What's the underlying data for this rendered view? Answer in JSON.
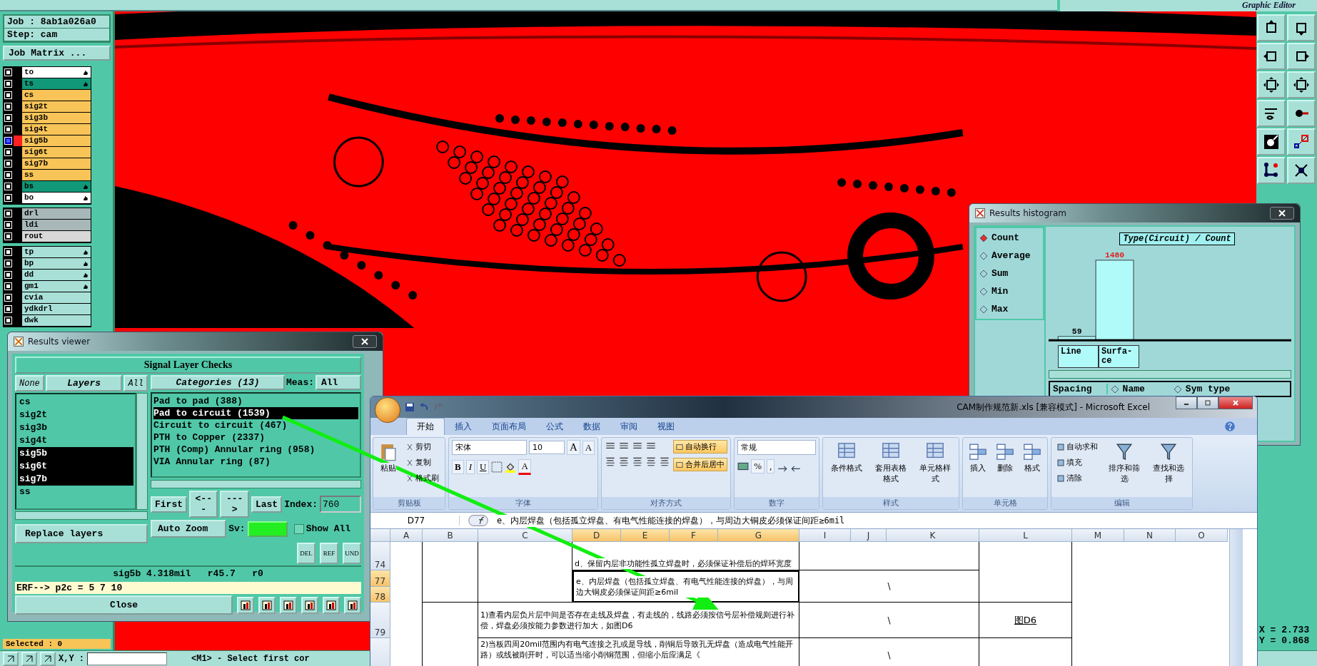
{
  "top_bar": {
    "subtitle": "Graphic Editor"
  },
  "job": {
    "job": "Job : 8ab1a026a0",
    "step": "Step: cam",
    "matrix_button": "Job Matrix ..."
  },
  "layer_groups": [
    {
      "layers": [
        {
          "name": "to",
          "color": "#ffffff",
          "selected": false,
          "marked": true
        },
        {
          "name": "ts",
          "color": "#109878",
          "selected": false,
          "marked": true
        },
        {
          "name": "cs",
          "color": "#f8c458",
          "selected": false,
          "marked": false
        },
        {
          "name": "sig2t",
          "color": "#f8c458",
          "selected": false,
          "marked": false
        },
        {
          "name": "sig3b",
          "color": "#f8c458",
          "selected": false,
          "marked": false
        },
        {
          "name": "sig4t",
          "color": "#f8c458",
          "selected": false,
          "marked": false
        },
        {
          "name": "sig5b",
          "color": "#f8c458",
          "selected": true,
          "marked": false
        },
        {
          "name": "sig6t",
          "color": "#f8c458",
          "selected": false,
          "marked": false
        },
        {
          "name": "sig7b",
          "color": "#f8c458",
          "selected": false,
          "marked": false
        },
        {
          "name": "ss",
          "color": "#f8c458",
          "selected": false,
          "marked": false
        },
        {
          "name": "bs",
          "color": "#109878",
          "selected": false,
          "marked": true
        },
        {
          "name": "bo",
          "color": "#ffffff",
          "selected": false,
          "marked": true
        }
      ]
    },
    {
      "layers": [
        {
          "name": "drl",
          "color": "#a8b8b8",
          "selected": false,
          "marked": false
        },
        {
          "name": "ldi",
          "color": "#a8b8b8",
          "selected": false,
          "marked": false
        },
        {
          "name": "rout",
          "color": "#d8d8d8",
          "selected": false,
          "marked": false
        }
      ]
    },
    {
      "layers": [
        {
          "name": "tp",
          "color": "#a8e0d8",
          "selected": false,
          "marked": true
        },
        {
          "name": "bp",
          "color": "#a8e0d8",
          "selected": false,
          "marked": true
        },
        {
          "name": "dd",
          "color": "#a8e0d8",
          "selected": false,
          "marked": true
        },
        {
          "name": "gm1",
          "color": "#a8e0d8",
          "selected": false,
          "marked": true
        },
        {
          "name": "cvia",
          "color": "#a8e0d8",
          "selected": false,
          "marked": false
        },
        {
          "name": "ydkdrl",
          "color": "#a8e0d8",
          "selected": false,
          "marked": false
        },
        {
          "name": "dwk",
          "color": "#a8e0d8",
          "selected": false,
          "marked": false
        }
      ]
    }
  ],
  "status": {
    "selected": "Selected : 0",
    "mouse_label": "X,Y :",
    "prompt": "<M1> - Select first cor"
  },
  "coords": {
    "x": "X = 2.733",
    "y": "Y = 0.868"
  },
  "results_viewer": {
    "title": "Results viewer",
    "header": "Signal Layer Checks",
    "layer_tabs": [
      {
        "label": "None",
        "selected": false
      },
      {
        "label": "Layers",
        "selected": true
      },
      {
        "label": "All",
        "selected": false
      }
    ],
    "layers": [
      {
        "name": "cs",
        "selected": false
      },
      {
        "name": "sig2t",
        "selected": false
      },
      {
        "name": "sig3b",
        "selected": false
      },
      {
        "name": "sig4t",
        "selected": false
      },
      {
        "name": "sig5b",
        "selected": true
      },
      {
        "name": "sig6t",
        "selected": true
      },
      {
        "name": "sig7b",
        "selected": true
      },
      {
        "name": "ss",
        "selected": false
      }
    ],
    "replace_dropdown": "Replace layers",
    "categories_button": "Categories (13)",
    "meas_label": "Meas:",
    "meas_value": "All",
    "categories": [
      {
        "label": "Pad to pad (388)",
        "selected": false
      },
      {
        "label": "Pad to circuit (1539)",
        "selected": true
      },
      {
        "label": "Circuit to circuit (467)",
        "selected": false
      },
      {
        "label": "PTH to Copper (2337)",
        "selected": false
      },
      {
        "label": "PTH (Comp) Annular ring (958)",
        "selected": false
      },
      {
        "label": "VIA Annular ring (87)",
        "selected": false
      }
    ],
    "nav_buttons": [
      "First",
      "<---",
      "--->",
      "Last"
    ],
    "index_label": "Index:",
    "index_value": "760",
    "zoom_dropdown": "Auto Zoom",
    "sv_label": "Sv:",
    "show_all": {
      "label": "Show All",
      "checked": false
    },
    "action_buttons": [
      "DEL",
      "REF",
      "UND"
    ],
    "measurement": "sig5b 4.318mil   r45.7   r0",
    "erf": "ERF--> p2c = 5 7 10",
    "close": "Close"
  },
  "histogram": {
    "title": "Results histogram",
    "options": [
      {
        "label": "Count",
        "selected": true
      },
      {
        "label": "Average",
        "selected": false
      },
      {
        "label": "Sum",
        "selected": false
      },
      {
        "label": "Min",
        "selected": false
      },
      {
        "label": "Max",
        "selected": false
      }
    ],
    "chart_data": {
      "type": "bar",
      "title": "Type(Circuit) / Count",
      "categories": [
        "Line",
        "Surfa-ce"
      ],
      "values": [
        59,
        1480
      ],
      "data_labels": true
    },
    "sort_label": "Spacing",
    "columns": [
      {
        "label": "Name",
        "selected": false
      },
      {
        "label": "Sym type",
        "selected": false
      }
    ]
  },
  "excel": {
    "title": "CAM制作规范新.xls  [兼容模式] - Microsoft Excel",
    "tabs": [
      {
        "label": "开始",
        "selected": true
      },
      {
        "label": "插入",
        "selected": false
      },
      {
        "label": "页面布局",
        "selected": false
      },
      {
        "label": "公式",
        "selected": false
      },
      {
        "label": "数据",
        "selected": false
      },
      {
        "label": "审阅",
        "selected": false
      },
      {
        "label": "视图",
        "selected": false
      }
    ],
    "clipboard": {
      "title": "剪贴板",
      "paste": "粘贴",
      "items": [
        "剪切",
        "复制",
        "格式刷"
      ]
    },
    "font": {
      "title": "字体",
      "name": "宋体",
      "size": "10",
      "styles": [
        "B",
        "I",
        "U"
      ],
      "size_buttons": [
        "A",
        "A"
      ],
      "color_letter": "A"
    },
    "alignment": {
      "title": "对齐方式",
      "buttons": [
        {
          "label": "自动换行",
          "on": true
        },
        {
          "label": "合并后居中",
          "on": true
        }
      ]
    },
    "number": {
      "title": "数字",
      "format": "常规",
      "buttons": [
        "%",
        ","
      ]
    },
    "styles": {
      "title": "样式",
      "items": [
        "条件格式",
        "套用表格格式",
        "单元格样式"
      ]
    },
    "cells": {
      "title": "单元格",
      "items": [
        "插入",
        "删除",
        "格式"
      ]
    },
    "editing": {
      "title": "编辑",
      "items": [
        "自动求和",
        "填充",
        "清除"
      ],
      "big": [
        "排序和筛选",
        "查找和选择"
      ]
    },
    "name_box": "D77",
    "formula": "e、内层焊盘（包括孤立焊盘、有电气性能连接的焊盘），与周边大铜皮必须保证间距≥6mil",
    "columns": [
      {
        "label": "A",
        "selected": false
      },
      {
        "label": "B",
        "selected": false
      },
      {
        "label": "C",
        "selected": false
      },
      {
        "label": "D",
        "selected": true
      },
      {
        "label": "E",
        "selected": true
      },
      {
        "label": "F",
        "selected": true
      },
      {
        "label": "G",
        "selected": true
      },
      {
        "label": "I",
        "selected": false
      },
      {
        "label": "J",
        "selected": false
      },
      {
        "label": "K",
        "selected": false
      },
      {
        "label": "L",
        "selected": false
      },
      {
        "label": "M",
        "selected": false
      },
      {
        "label": "N",
        "selected": false
      },
      {
        "label": "O",
        "selected": false
      }
    ],
    "rows": [
      {
        "number": "74",
        "selected": false
      },
      {
        "number": "77",
        "selected": true
      },
      {
        "number": "78",
        "selected": true
      },
      {
        "number": "79",
        "selected": false
      }
    ],
    "items": [
      {
        "text": "d、保留内层非功能性孤立焊盘时，必须保证补偿后的焊环宽度"
      },
      {
        "text": "e、内层焊盘（包括孤立焊盘、有电气性能连接的焊盘），与周边大铜皮必须保证间距≥6mil",
        "mark": "\\"
      },
      {
        "text": "1)查看内层负片层中间是否存在走线及焊盘，有走线的，线路必须按信号层补偿规则进行补偿，焊盘必须按能力参数进行加大，如图D6",
        "mark": "\\",
        "figure": "图D6"
      },
      {
        "text": "2)当板四周20mil范围内有电气连接之孔或是导线，削铜后导致孔无焊盘（造成电气性能开路）或线被削开时，可以适当缩小削铜范围，但缩小后应满足《",
        "mark": "\\"
      }
    ]
  }
}
